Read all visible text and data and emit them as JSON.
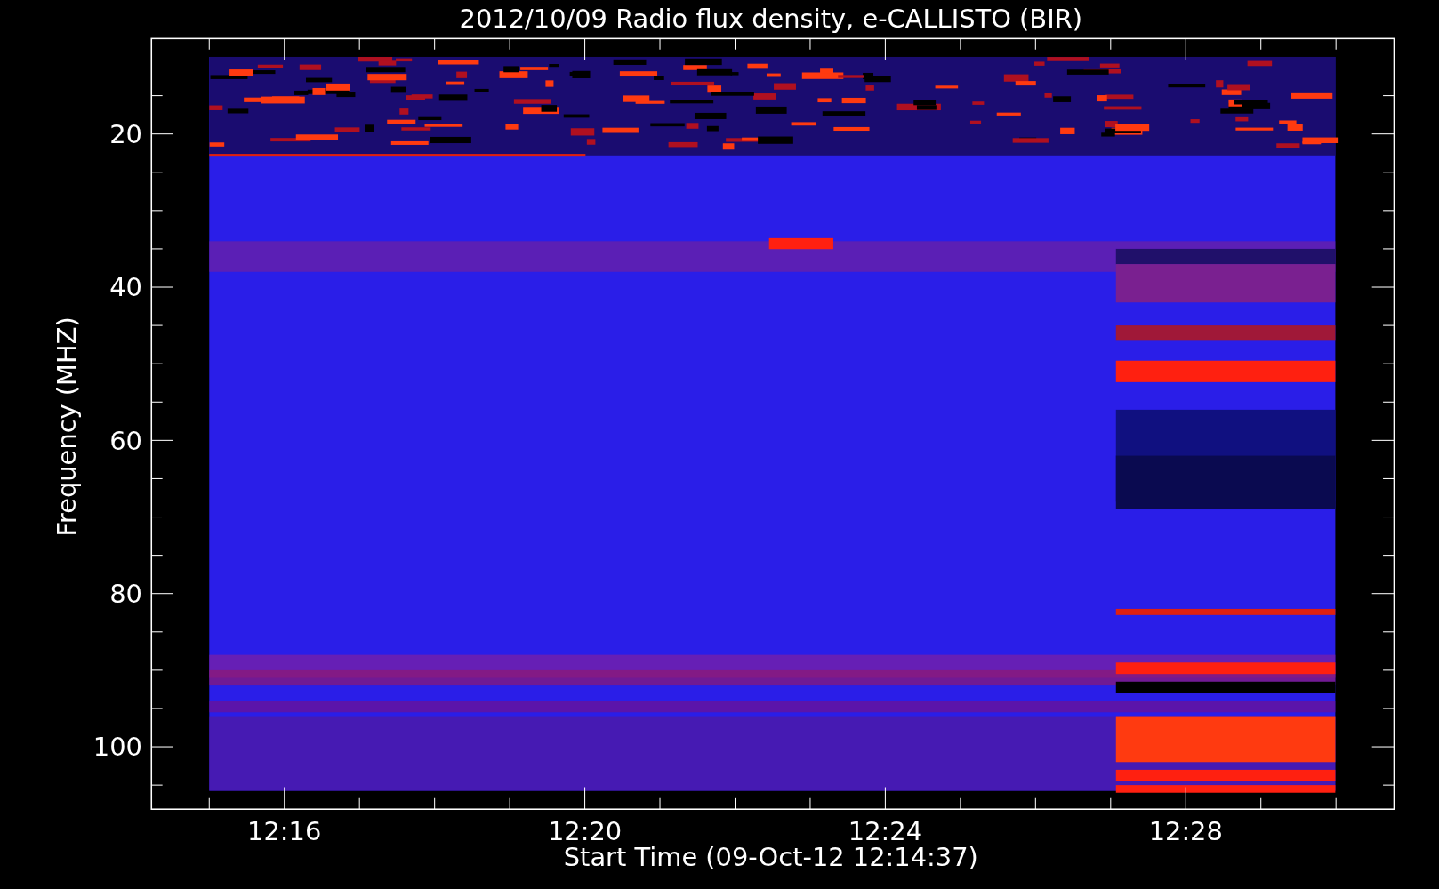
{
  "title": "2012/10/09  Radio flux density, e-CALLISTO (BIR)",
  "y_axis": {
    "label": "Frequency (MHZ)",
    "ticks": [
      "20",
      "40",
      "60",
      "80",
      "100"
    ]
  },
  "x_axis": {
    "label": "Start Time (09-Oct-12 12:14:37)",
    "ticks": [
      "12:16",
      "12:20",
      "12:24",
      "12:28"
    ]
  }
}
